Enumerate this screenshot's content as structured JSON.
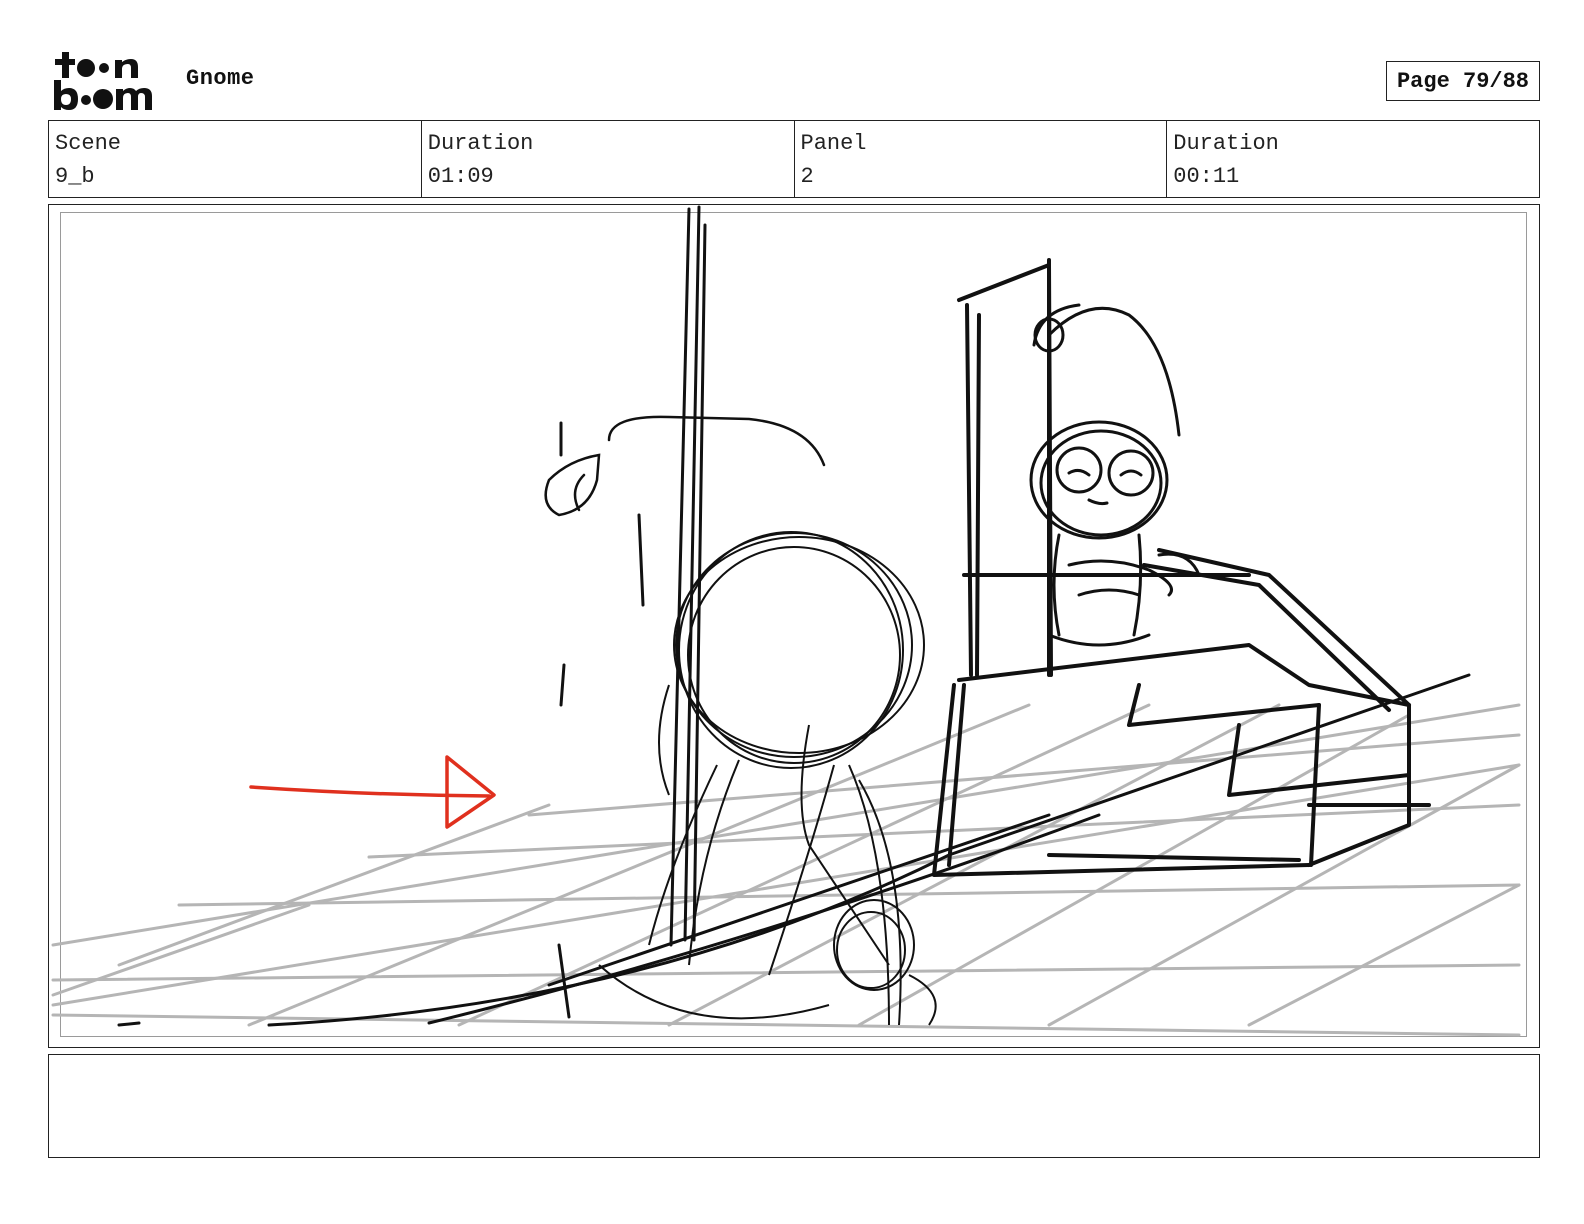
{
  "header": {
    "logo_text": "toon boom",
    "project_title": "Gnome",
    "page_label": "Page 79/88"
  },
  "info": {
    "scene_label": "Scene",
    "scene_value": "9_b",
    "scene_duration_label": "Duration",
    "scene_duration_value": "01:09",
    "panel_label": "Panel",
    "panel_value": "2",
    "panel_duration_label": "Duration",
    "panel_duration_value": "00:11"
  },
  "panel": {
    "drawing": "rough storyboard sketch",
    "arrow_color": "#e0301e",
    "line_color": "#111111",
    "grid_color": "#b5b5b5"
  },
  "notes": {
    "text": ""
  }
}
